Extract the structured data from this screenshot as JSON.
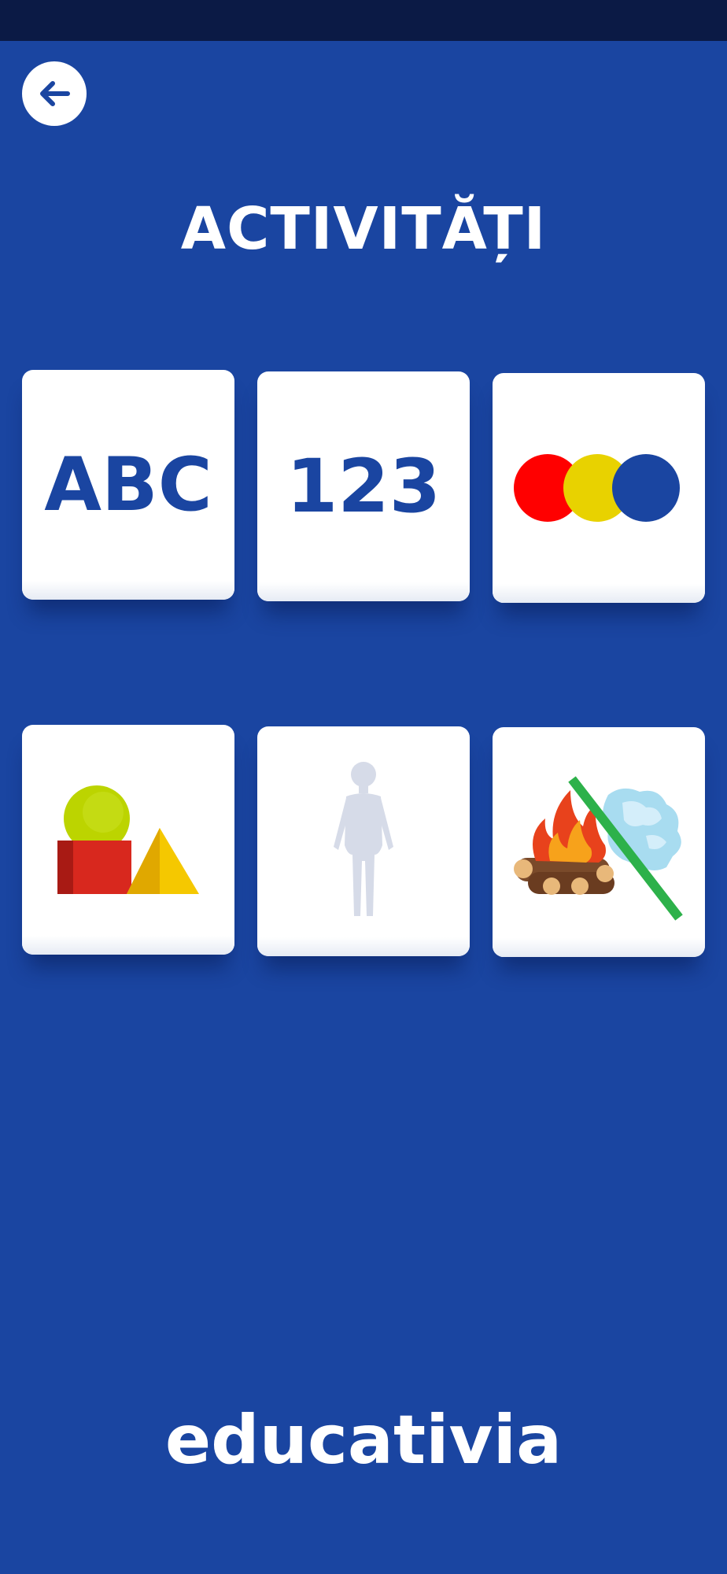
{
  "header": {
    "back_icon": "arrow-left-icon",
    "title": "ACTIVITĂȚI"
  },
  "activities": [
    {
      "label": "ABC",
      "icon": "letters-icon"
    },
    {
      "label": "123",
      "icon": "numbers-icon"
    },
    {
      "label": "",
      "icon": "colors-icon",
      "colors": [
        "#ff0000",
        "#e8d200",
        "#1a45a1"
      ]
    },
    {
      "label": "",
      "icon": "shapes-icon",
      "colors": [
        "#bcd400",
        "#d8281e",
        "#f5c800"
      ]
    },
    {
      "label": "",
      "icon": "human-body-icon",
      "colors": [
        "#d6dbe8"
      ]
    },
    {
      "label": "",
      "icon": "hot-cold-icon",
      "colors": [
        "#e8421c",
        "#7a4a2a",
        "#a8dcf0",
        "#2db14a"
      ]
    }
  ],
  "footer": {
    "brand": "educativia"
  },
  "theme": {
    "background": "#1a45a1",
    "statusbar": "#0b1a45",
    "card": "#ffffff"
  }
}
